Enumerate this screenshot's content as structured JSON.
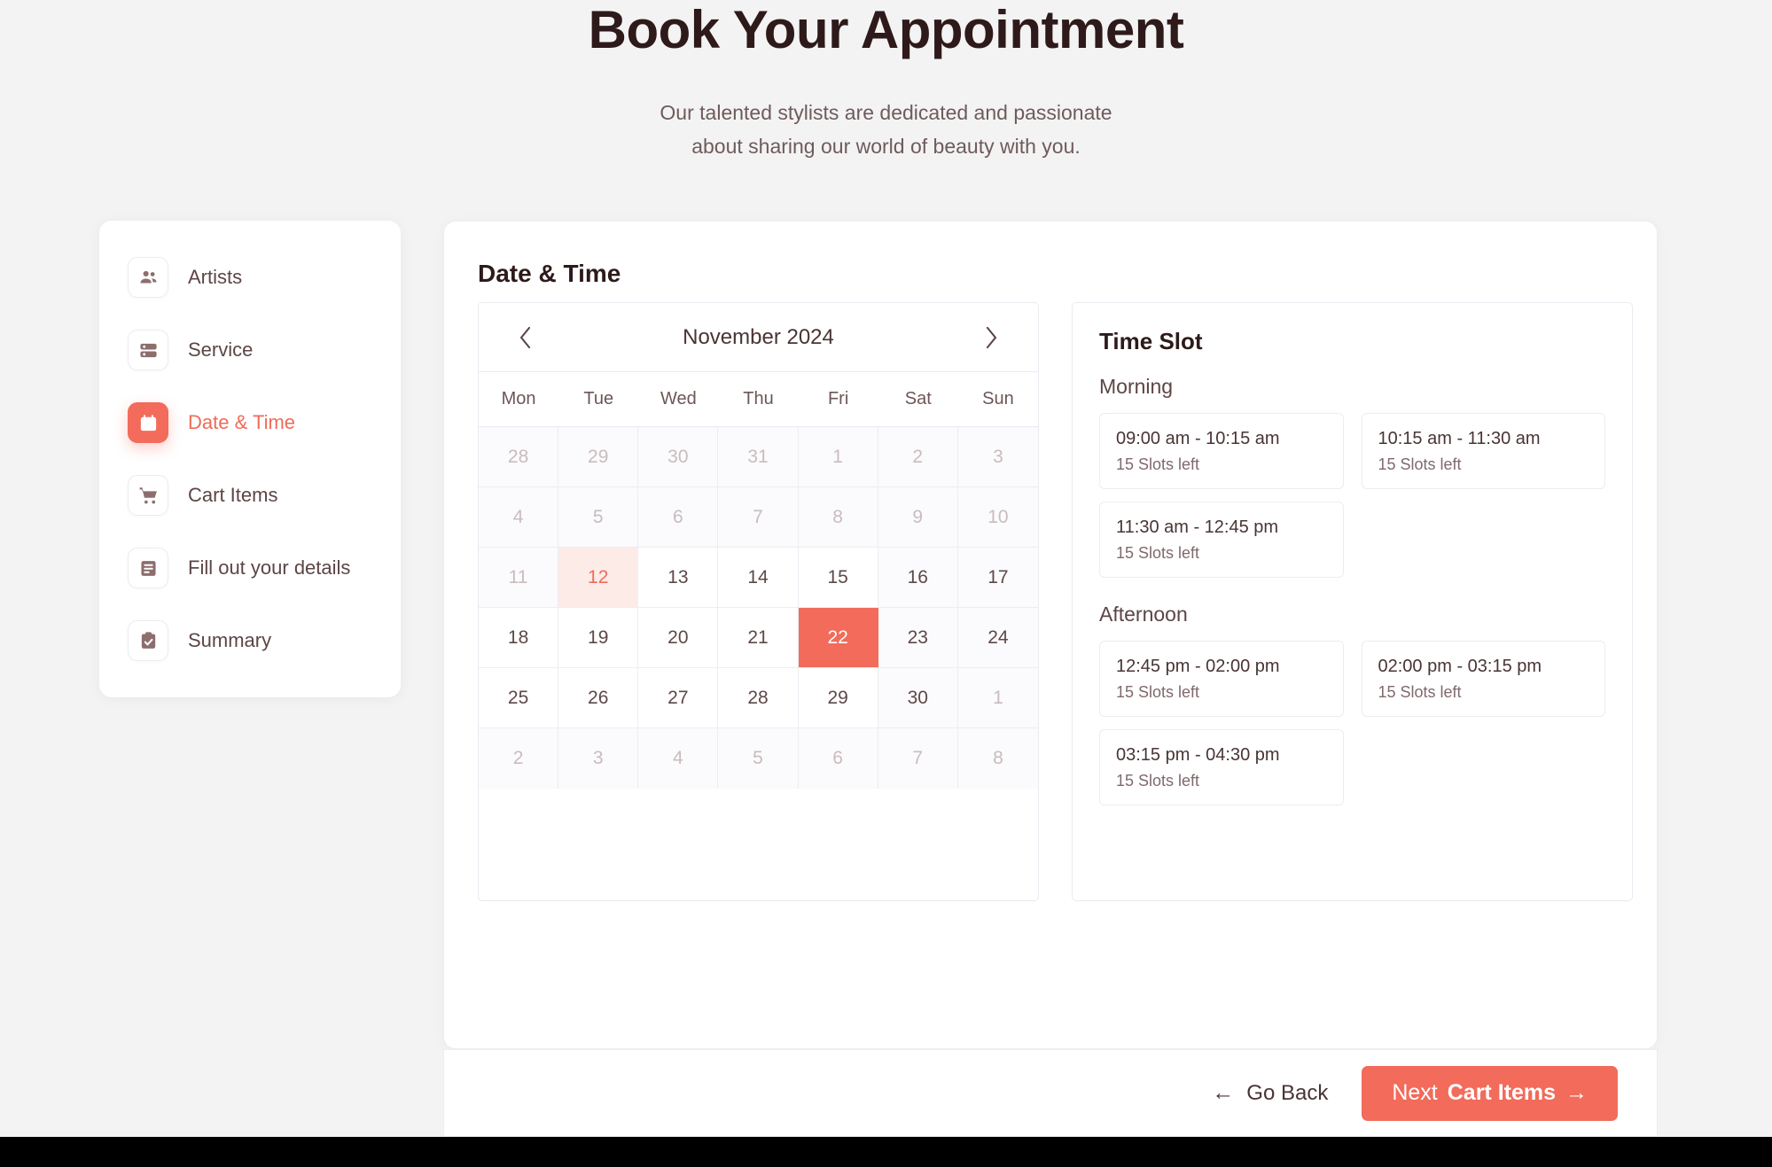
{
  "hero": {
    "title": "Book Your Appointment",
    "subtitle_line1": "Our talented stylists are dedicated and passionate",
    "subtitle_line2": "about sharing our world of beauty with you."
  },
  "colors": {
    "accent": "#F26B5B",
    "accent_text": "#EF6B58",
    "today_bg": "#FDEBE7",
    "page_bg": "#F4F3F4",
    "heading": "#2E1A1A",
    "muted_text": "#C9BCBC",
    "border": "#E9EBF2"
  },
  "sidebar": {
    "items": [
      {
        "label": "Artists",
        "icon": "people-icon",
        "active": false
      },
      {
        "label": "Service",
        "icon": "server-stack-icon",
        "active": false
      },
      {
        "label": "Date & Time",
        "icon": "calendar-icon",
        "active": true
      },
      {
        "label": "Cart Items",
        "icon": "shopping-cart-icon",
        "active": false
      },
      {
        "label": "Fill out your details",
        "icon": "form-document-icon",
        "active": false
      },
      {
        "label": "Summary",
        "icon": "clipboard-check-icon",
        "active": false
      }
    ]
  },
  "main": {
    "title": "Date & Time"
  },
  "calendar": {
    "month_label": "November 2024",
    "prev_icon": "chevron-left-icon",
    "next_icon": "chevron-right-icon",
    "day_headers": [
      "Mon",
      "Tue",
      "Wed",
      "Thu",
      "Fri",
      "Sat",
      "Sun"
    ],
    "selected_day": 22,
    "today_day": 12,
    "weeks": [
      [
        {
          "d": "28",
          "state": "muted"
        },
        {
          "d": "29",
          "state": "muted"
        },
        {
          "d": "30",
          "state": "muted"
        },
        {
          "d": "31",
          "state": "muted"
        },
        {
          "d": "1",
          "state": "muted"
        },
        {
          "d": "2",
          "state": "muted"
        },
        {
          "d": "3",
          "state": "muted"
        }
      ],
      [
        {
          "d": "4",
          "state": "muted"
        },
        {
          "d": "5",
          "state": "muted"
        },
        {
          "d": "6",
          "state": "muted"
        },
        {
          "d": "7",
          "state": "muted"
        },
        {
          "d": "8",
          "state": "muted"
        },
        {
          "d": "9",
          "state": "muted"
        },
        {
          "d": "10",
          "state": "muted"
        }
      ],
      [
        {
          "d": "11",
          "state": "muted"
        },
        {
          "d": "12",
          "state": "today"
        },
        {
          "d": "13",
          "state": "normal"
        },
        {
          "d": "14",
          "state": "normal"
        },
        {
          "d": "15",
          "state": "normal"
        },
        {
          "d": "16",
          "state": "weekend"
        },
        {
          "d": "17",
          "state": "weekend"
        }
      ],
      [
        {
          "d": "18",
          "state": "normal"
        },
        {
          "d": "19",
          "state": "normal"
        },
        {
          "d": "20",
          "state": "normal"
        },
        {
          "d": "21",
          "state": "normal"
        },
        {
          "d": "22",
          "state": "selected"
        },
        {
          "d": "23",
          "state": "weekend"
        },
        {
          "d": "24",
          "state": "weekend"
        }
      ],
      [
        {
          "d": "25",
          "state": "normal"
        },
        {
          "d": "26",
          "state": "normal"
        },
        {
          "d": "27",
          "state": "normal"
        },
        {
          "d": "28",
          "state": "normal"
        },
        {
          "d": "29",
          "state": "normal"
        },
        {
          "d": "30",
          "state": "weekend"
        },
        {
          "d": "1",
          "state": "muted"
        }
      ],
      [
        {
          "d": "2",
          "state": "muted"
        },
        {
          "d": "3",
          "state": "muted"
        },
        {
          "d": "4",
          "state": "muted"
        },
        {
          "d": "5",
          "state": "muted"
        },
        {
          "d": "6",
          "state": "muted"
        },
        {
          "d": "7",
          "state": "muted"
        },
        {
          "d": "8",
          "state": "muted"
        }
      ]
    ]
  },
  "time_slot": {
    "title": "Time Slot",
    "periods": [
      {
        "name": "Morning",
        "slots": [
          {
            "time": "09:00 am - 10:15 am",
            "left": "15 Slots left"
          },
          {
            "time": "10:15 am - 11:30 am",
            "left": "15 Slots left"
          },
          {
            "time": "11:30 am - 12:45 pm",
            "left": "15 Slots left"
          }
        ]
      },
      {
        "name": "Afternoon",
        "slots": [
          {
            "time": "12:45 pm - 02:00 pm",
            "left": "15 Slots left"
          },
          {
            "time": "02:00 pm - 03:15 pm",
            "left": "15 Slots left"
          },
          {
            "time": "03:15 pm - 04:30 pm",
            "left": "15 Slots left"
          }
        ]
      }
    ]
  },
  "footer": {
    "back_label": "Go Back",
    "back_arrow": "←",
    "next_label_light": "Next",
    "next_label_bold": "Cart Items",
    "next_arrow": "→"
  }
}
